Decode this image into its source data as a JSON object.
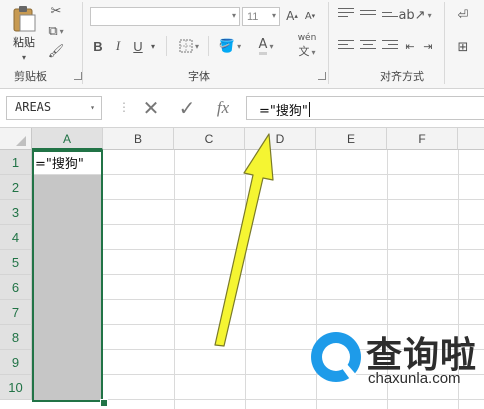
{
  "ribbon": {
    "clipboard": {
      "paste_label": "粘贴",
      "group_label": "剪贴板"
    },
    "font": {
      "font_name": "",
      "font_size": "11",
      "bold": "B",
      "italic": "I",
      "underline": "U",
      "font_color_glyph": "A",
      "phonetic_label": "wén",
      "group_label": "字体"
    },
    "alignment": {
      "group_label": "对齐方式"
    }
  },
  "formula_bar": {
    "name_box": "AREAS",
    "fx_label": "fx",
    "formula": "=\"搜狗\""
  },
  "sheet": {
    "columns": [
      "A",
      "B",
      "C",
      "D",
      "E",
      "F"
    ],
    "rows": [
      "1",
      "2",
      "3",
      "4",
      "5",
      "6",
      "7",
      "8",
      "9",
      "10"
    ],
    "cells": {
      "A1": "=\"搜狗\""
    },
    "selected_column": "A",
    "selection_color": "#217346"
  },
  "annotation": {
    "arrow_color": "#f5f532",
    "arrow_points_to": "formula_bar"
  },
  "watermark": {
    "logo_text": "查询啦",
    "domain": "chaxunla.com",
    "logo_color": "#1e9be9"
  }
}
